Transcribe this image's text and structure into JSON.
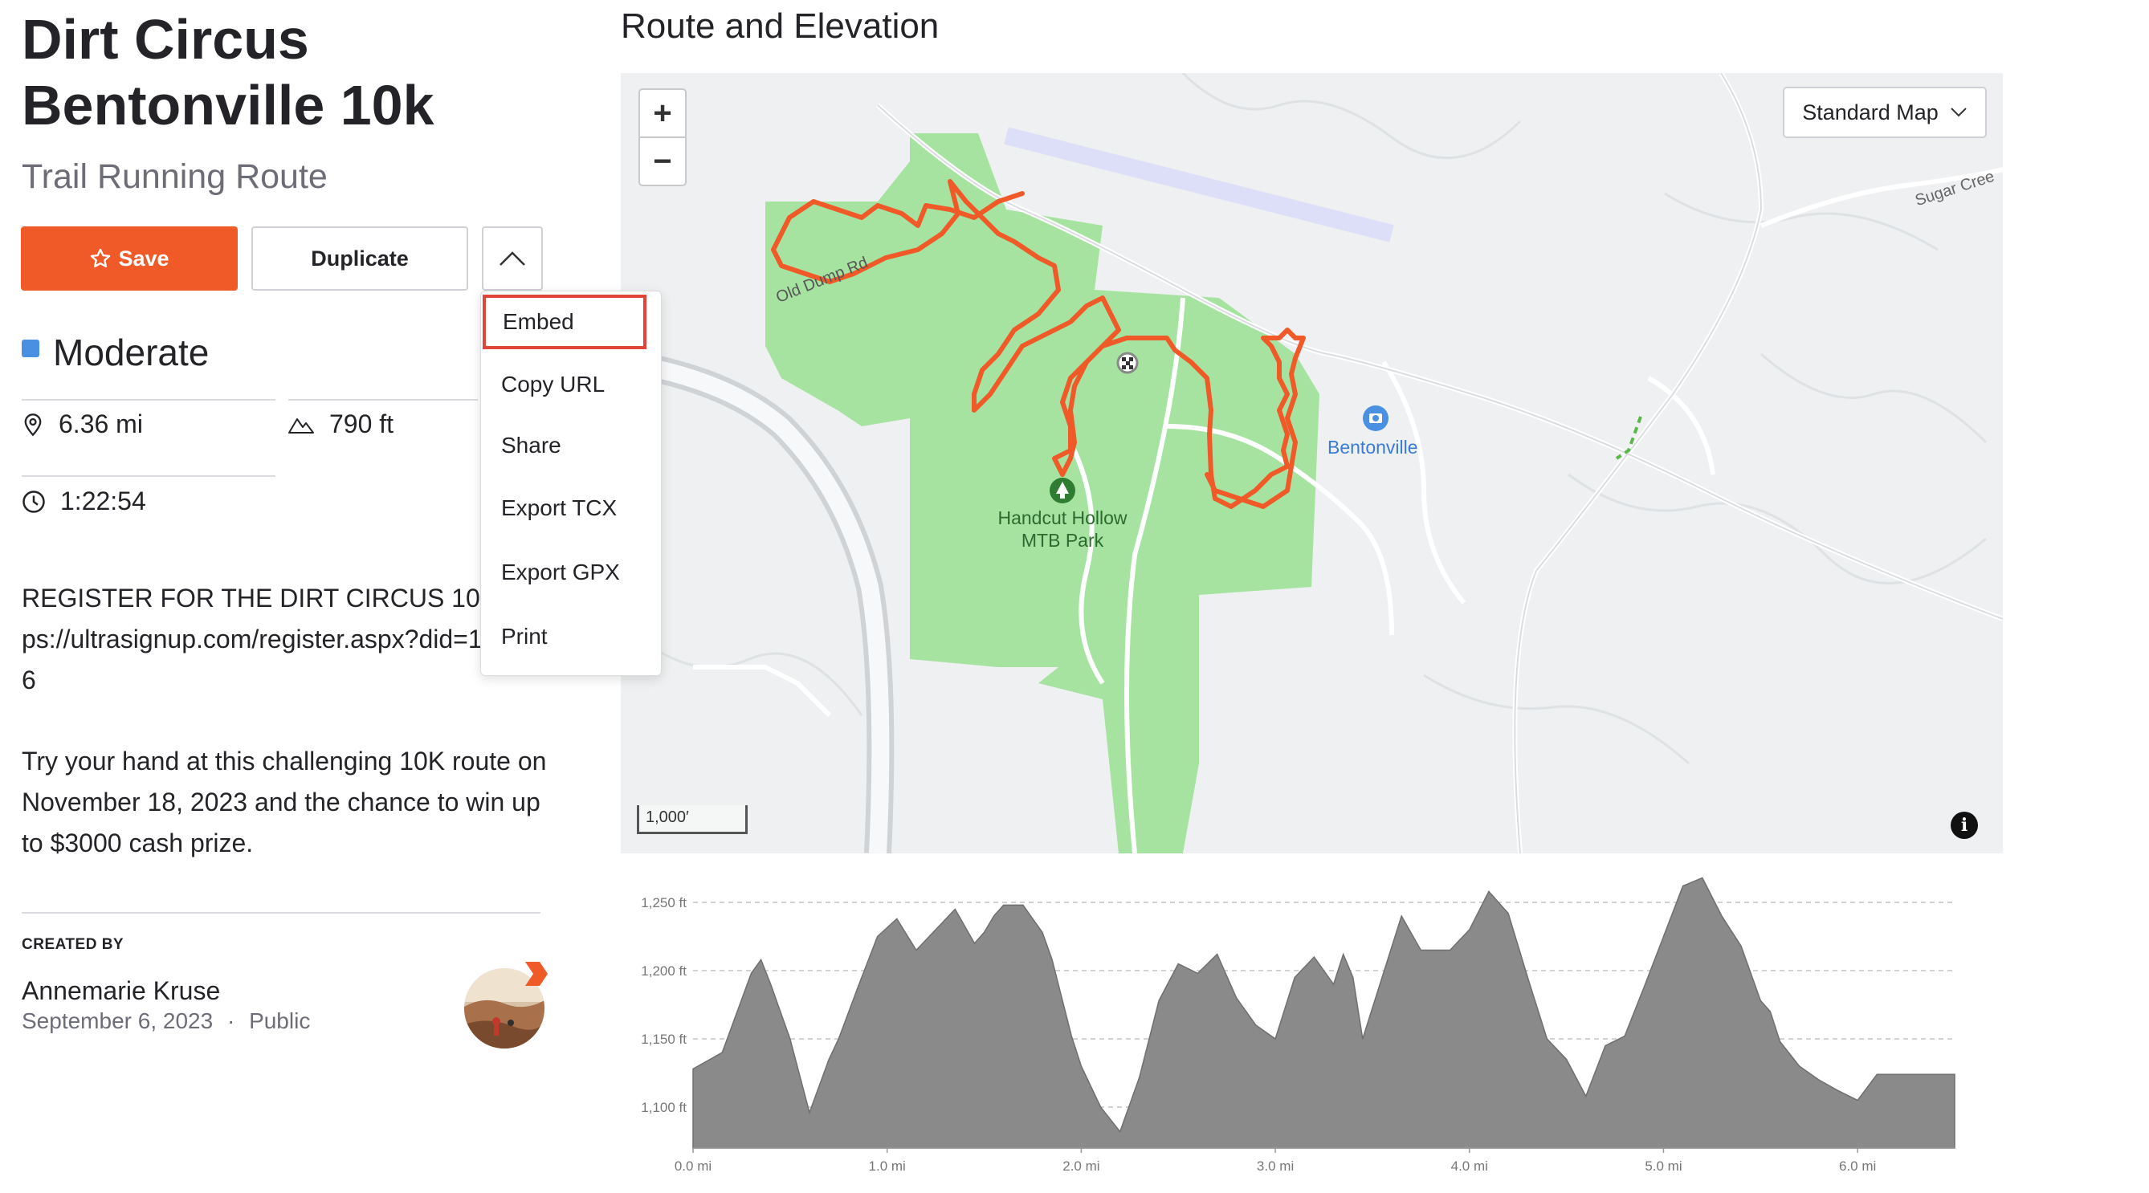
{
  "route": {
    "title": "Dirt Circus Bentonville 10k",
    "type": "Trail Running Route",
    "difficulty": "Moderate",
    "distance": "6.36 mi",
    "elevation_gain": "790 ft",
    "duration": "1:22:54"
  },
  "actions": {
    "save_label": "Save",
    "duplicate_label": "Duplicate"
  },
  "menu": {
    "items": [
      "Embed",
      "Copy URL",
      "Share",
      "Export TCX",
      "Export GPX",
      "Print"
    ],
    "highlighted": "Embed"
  },
  "description": {
    "register": "REGISTER FOR THE DIRT CIRCUS 10K: https://ultrasignup.com/register.aspx?did=103706",
    "promo": "Try your hand at this challenging 10K route on November 18, 2023 and the chance to win up to $3000 cash prize."
  },
  "creator": {
    "label": "CREATED BY",
    "name": "Annemarie Kruse",
    "date": "September 6, 2023",
    "separator": "·",
    "visibility": "Public"
  },
  "map": {
    "section_title": "Route and Elevation",
    "map_type": "Standard Map",
    "zoom_in": "+",
    "zoom_out": "−",
    "scale_label": "1,000′",
    "info": "i",
    "labels": {
      "road_old_dump": "Old Dump Rd",
      "road_sugar_creek": "Sugar Cree",
      "place_bentonville": "Bentonville",
      "park_name_line1": "Handcut Hollow",
      "park_name_line2": "MTB Park"
    },
    "colors": {
      "route": "#f05a28",
      "park": "#a6e3a1",
      "background": "#eef0f1",
      "place": "#4a90e2"
    }
  },
  "colors": {
    "accent": "#f05a28",
    "difficulty": "#4a90e2",
    "elevation_fill": "#8a8a8a"
  },
  "chart_data": {
    "type": "area",
    "title": "",
    "xlabel": "",
    "ylabel": "",
    "x_ticks": [
      "0.0 mi",
      "1.0 mi",
      "2.0 mi",
      "3.0 mi",
      "4.0 mi",
      "5.0 mi",
      "6.0 mi"
    ],
    "y_ticks": [
      "1,100 ft",
      "1,150 ft",
      "1,200 ft",
      "1,250 ft"
    ],
    "xlim": [
      0,
      6.5
    ],
    "ylim": [
      1070,
      1270
    ],
    "grid": true,
    "x": [
      0.0,
      0.15,
      0.3,
      0.35,
      0.4,
      0.5,
      0.6,
      0.7,
      0.75,
      0.85,
      0.95,
      1.05,
      1.15,
      1.25,
      1.35,
      1.45,
      1.5,
      1.55,
      1.6,
      1.7,
      1.8,
      1.85,
      1.9,
      1.95,
      2.0,
      2.1,
      2.2,
      2.3,
      2.4,
      2.5,
      2.6,
      2.7,
      2.8,
      2.9,
      3.0,
      3.1,
      3.2,
      3.3,
      3.35,
      3.4,
      3.45,
      3.55,
      3.65,
      3.75,
      3.9,
      4.0,
      4.1,
      4.2,
      4.3,
      4.4,
      4.5,
      4.6,
      4.7,
      4.8,
      4.9,
      5.0,
      5.1,
      5.2,
      5.3,
      5.4,
      5.5,
      5.55,
      5.6,
      5.7,
      5.8,
      5.9,
      6.0,
      6.1,
      6.2,
      6.25,
      6.35,
      6.5
    ],
    "values": [
      1128,
      1140,
      1198,
      1208,
      1190,
      1150,
      1096,
      1135,
      1150,
      1188,
      1225,
      1238,
      1215,
      1230,
      1245,
      1220,
      1228,
      1240,
      1248,
      1248,
      1228,
      1208,
      1180,
      1152,
      1130,
      1100,
      1082,
      1122,
      1178,
      1205,
      1198,
      1212,
      1180,
      1160,
      1150,
      1195,
      1210,
      1190,
      1212,
      1195,
      1150,
      1195,
      1240,
      1215,
      1215,
      1230,
      1258,
      1242,
      1195,
      1150,
      1135,
      1108,
      1145,
      1152,
      1188,
      1225,
      1262,
      1268,
      1240,
      1218,
      1178,
      1170,
      1148,
      1130,
      1120,
      1112,
      1105,
      1124,
      1124,
      1124,
      1124,
      1124
    ]
  }
}
